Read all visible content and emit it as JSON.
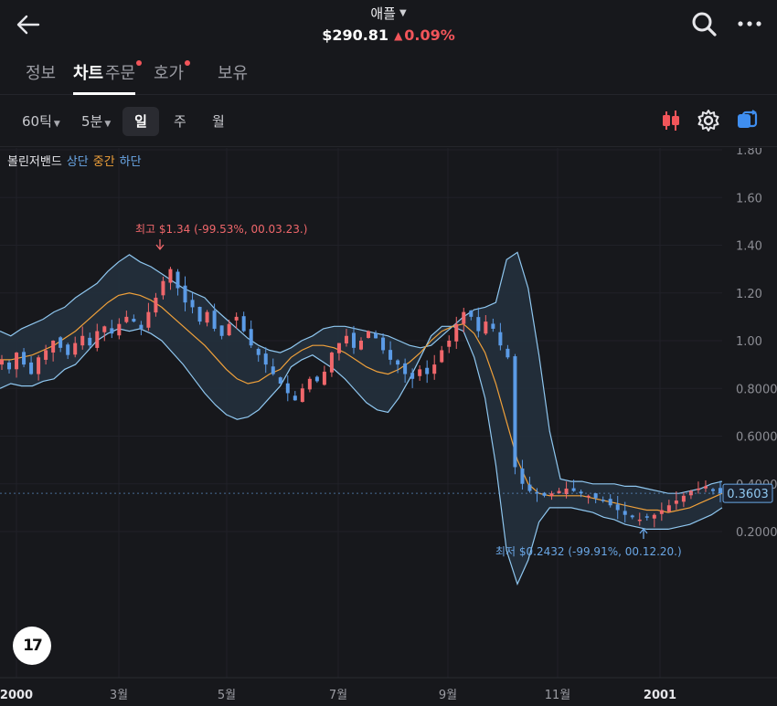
{
  "header": {
    "title": "애플",
    "price": "$290.81",
    "change": "0.09%"
  },
  "tabs": [
    {
      "label": "정보",
      "active": false,
      "dot": false
    },
    {
      "label": "차트",
      "active": true,
      "dot": false
    },
    {
      "label": "주문",
      "active": false,
      "dot": true
    },
    {
      "label": "호가",
      "active": false,
      "dot": true
    },
    {
      "label": "보유",
      "active": false,
      "dot": false
    }
  ],
  "toolbar": {
    "tick": "60틱",
    "minute": "5분",
    "day": "일",
    "week": "주",
    "month": "월"
  },
  "legend": {
    "name": "볼린저밴드",
    "upper": "상단",
    "middle": "중간",
    "lower": "하단"
  },
  "annotations": {
    "high": "최고 $1.34 (-99.53%, 00.03.23.)",
    "low": "최저 $0.2432 (-99.91%, 00.12.20.)"
  },
  "logo_text": "17",
  "chart_data": {
    "type": "candlestick",
    "y_ticks": [
      "1.80",
      "1.60",
      "1.40",
      "1.20",
      "1.00",
      "0.8000",
      "0.6000",
      "0.4000",
      "0.2000"
    ],
    "ylim": [
      0.0,
      1.84
    ],
    "x_ticks": [
      "2000",
      "3월",
      "5월",
      "7월",
      "9월",
      "11월",
      "2001"
    ],
    "last_price_label": "0.3603",
    "last_price": 0.3603,
    "high": 1.34,
    "low": 0.2432,
    "series": [
      {
        "name": "상단",
        "color": "#8fc7f0"
      },
      {
        "name": "중간",
        "color": "#f0a13a"
      },
      {
        "name": "하단",
        "color": "#8fc7f0"
      }
    ],
    "colors": {
      "up": "#f0676b",
      "down": "#5b9be6",
      "band_fill": "#24303d",
      "band_line": "#8fc7f0",
      "mid_line": "#f0a13a"
    },
    "close": [
      0.92,
      0.88,
      0.95,
      0.9,
      0.86,
      0.93,
      0.96,
      1.0,
      0.97,
      0.94,
      0.99,
      1.02,
      0.98,
      1.04,
      1.06,
      1.03,
      1.07,
      1.1,
      1.08,
      1.05,
      1.12,
      1.18,
      1.25,
      1.3,
      1.22,
      1.16,
      1.14,
      1.08,
      1.12,
      1.05,
      1.02,
      1.07,
      1.1,
      1.04,
      0.98,
      0.94,
      0.9,
      0.86,
      0.82,
      0.78,
      0.75,
      0.8,
      0.84,
      0.83,
      0.87,
      0.95,
      0.99,
      1.02,
      0.97,
      1.0,
      1.04,
      1.01,
      0.96,
      0.92,
      0.9,
      0.86,
      0.84,
      0.88,
      0.86,
      0.9,
      0.96,
      1.0,
      1.07,
      1.12,
      1.1,
      1.04,
      1.08,
      1.05,
      0.98,
      0.93,
      0.47,
      0.4,
      0.37,
      0.36,
      0.35,
      0.36,
      0.37,
      0.38,
      0.37,
      0.36,
      0.35,
      0.34,
      0.33,
      0.31,
      0.29,
      0.27,
      0.26,
      0.25,
      0.26,
      0.27,
      0.29,
      0.31,
      0.33,
      0.35,
      0.37,
      0.38,
      0.39,
      0.37,
      0.36
    ],
    "upper": [
      1.04,
      1.02,
      1.05,
      1.07,
      1.09,
      1.12,
      1.14,
      1.18,
      1.21,
      1.24,
      1.29,
      1.33,
      1.36,
      1.33,
      1.31,
      1.28,
      1.25,
      1.22,
      1.2,
      1.18,
      1.13,
      1.09,
      1.05,
      1.01,
      0.98,
      0.96,
      0.95,
      0.97,
      1.0,
      1.02,
      1.05,
      1.06,
      1.06,
      1.05,
      1.04,
      1.03,
      1.02,
      1.0,
      0.98,
      0.97,
      0.98,
      1.02,
      1.06,
      1.1,
      1.13,
      1.14,
      1.16,
      1.34,
      1.37,
      1.22,
      0.94,
      0.62,
      0.42,
      0.41,
      0.41,
      0.4,
      0.4,
      0.4,
      0.39,
      0.39,
      0.38,
      0.37,
      0.36,
      0.36,
      0.37,
      0.38,
      0.4,
      0.41
    ],
    "middle": [
      0.92,
      0.92,
      0.93,
      0.94,
      0.96,
      0.98,
      1.01,
      1.04,
      1.08,
      1.12,
      1.16,
      1.19,
      1.2,
      1.19,
      1.17,
      1.14,
      1.1,
      1.06,
      1.02,
      0.98,
      0.93,
      0.88,
      0.84,
      0.82,
      0.83,
      0.86,
      0.88,
      0.93,
      0.96,
      0.98,
      0.98,
      0.97,
      0.95,
      0.92,
      0.89,
      0.87,
      0.86,
      0.88,
      0.91,
      0.95,
      1.0,
      1.04,
      1.06,
      1.07,
      1.03,
      0.95,
      0.82,
      0.66,
      0.5,
      0.4,
      0.36,
      0.35,
      0.35,
      0.35,
      0.35,
      0.34,
      0.33,
      0.32,
      0.31,
      0.3,
      0.29,
      0.29,
      0.28,
      0.29,
      0.3,
      0.32,
      0.34,
      0.36
    ],
    "lower": [
      0.8,
      0.82,
      0.81,
      0.81,
      0.83,
      0.84,
      0.88,
      0.9,
      0.95,
      1.0,
      1.03,
      1.05,
      1.04,
      1.05,
      1.03,
      1.0,
      0.95,
      0.9,
      0.84,
      0.78,
      0.73,
      0.69,
      0.67,
      0.68,
      0.71,
      0.76,
      0.81,
      0.89,
      0.92,
      0.94,
      0.91,
      0.88,
      0.84,
      0.79,
      0.74,
      0.71,
      0.7,
      0.76,
      0.84,
      0.93,
      1.02,
      1.06,
      1.06,
      1.04,
      0.93,
      0.76,
      0.48,
      0.12,
      -0.02,
      0.08,
      0.24,
      0.3,
      0.3,
      0.3,
      0.29,
      0.28,
      0.26,
      0.25,
      0.23,
      0.22,
      0.21,
      0.21,
      0.21,
      0.22,
      0.23,
      0.25,
      0.27,
      0.3
    ]
  }
}
